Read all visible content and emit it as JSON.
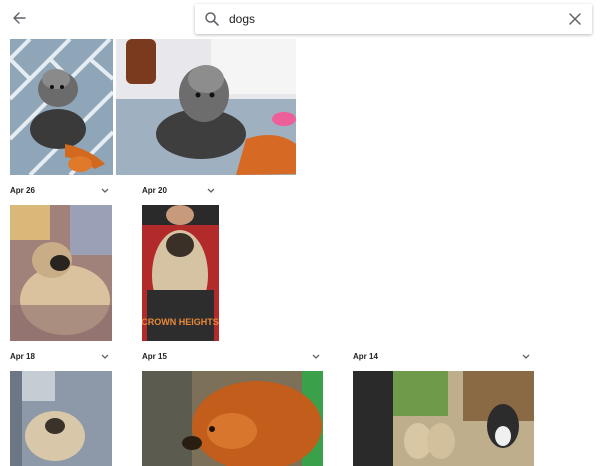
{
  "search": {
    "query": "dogs"
  },
  "colors": {
    "icon": "#5f6368",
    "text": "#202124"
  },
  "icons": {
    "back": "arrow-left-icon",
    "search": "search-icon",
    "clear": "close-icon",
    "expand": "chevron-down-icon"
  },
  "sections": [
    {
      "date": "Apr 26"
    },
    {
      "date": "Apr 20"
    },
    {
      "date": "Apr 18"
    },
    {
      "date": "Apr 15"
    },
    {
      "date": "Apr 14"
    }
  ],
  "photos": {
    "crown_heights_text": "CROWN HEIGHTS"
  }
}
